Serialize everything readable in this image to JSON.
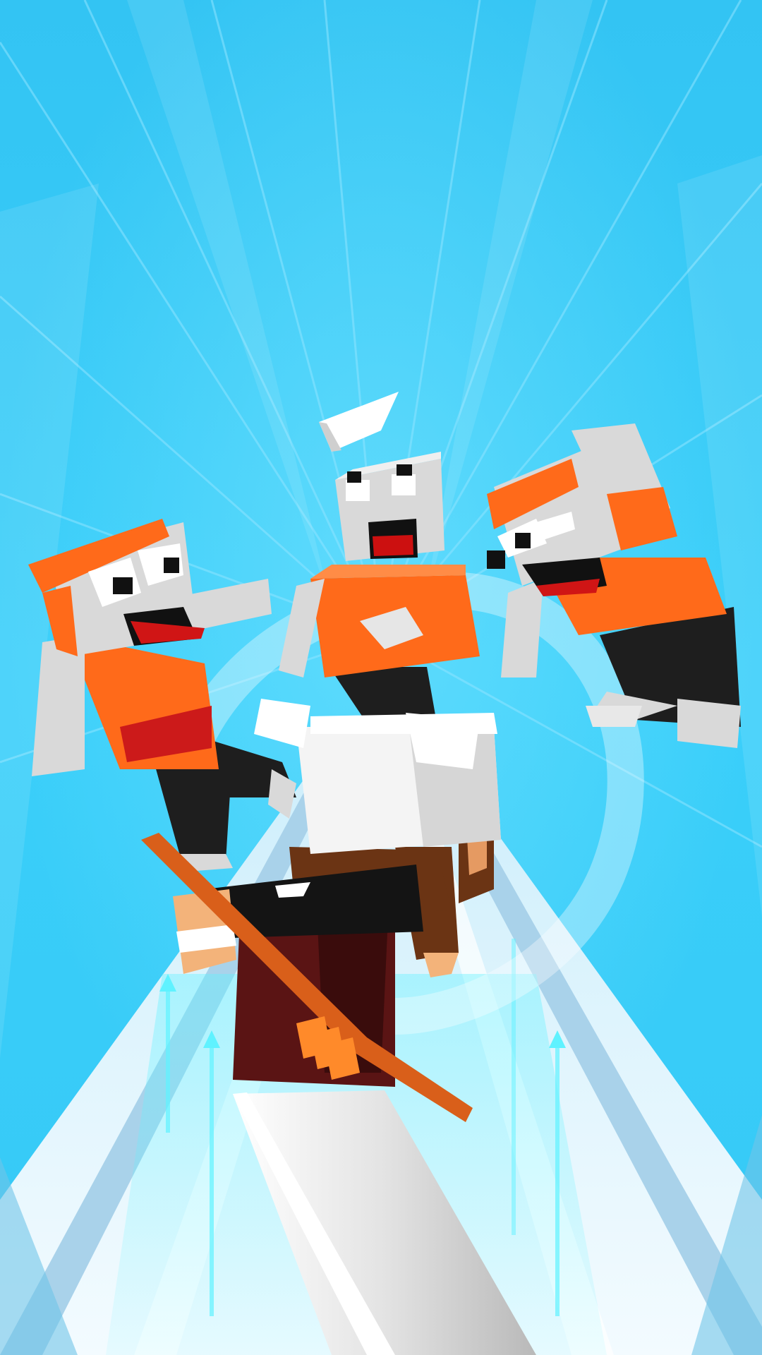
{
  "scene": {
    "kind": "game-promo-artwork",
    "characters": [
      {
        "name": "enemy-left",
        "colors": {
          "shirt": "#ff6a1a",
          "skin": "#d9d9d9",
          "pants": "#1e1e1e"
        }
      },
      {
        "name": "enemy-center",
        "colors": {
          "shirt": "#ff6a1a",
          "skin": "#d9d9d9",
          "pants": "#1e1e1e"
        }
      },
      {
        "name": "enemy-right",
        "colors": {
          "shirt": "#ff6a1a",
          "skin": "#d9d9d9",
          "pants": "#1e1e1e"
        }
      },
      {
        "name": "player-archer",
        "colors": {
          "head": "#f2f2f2",
          "shirt": "#141414",
          "pants": "#5a1414",
          "bow": "#d95f1a"
        }
      }
    ],
    "props": [
      "flying-arrow",
      "bow-swing-arc",
      "giant-sword",
      "boost-arrow-icons"
    ]
  },
  "colors": {
    "sky_top": "#33c6f4",
    "sky_mid": "#3ad1fb",
    "track": "#dff6ff",
    "track_rail": "#9fcbe6",
    "glow": "#5ff2ff"
  }
}
